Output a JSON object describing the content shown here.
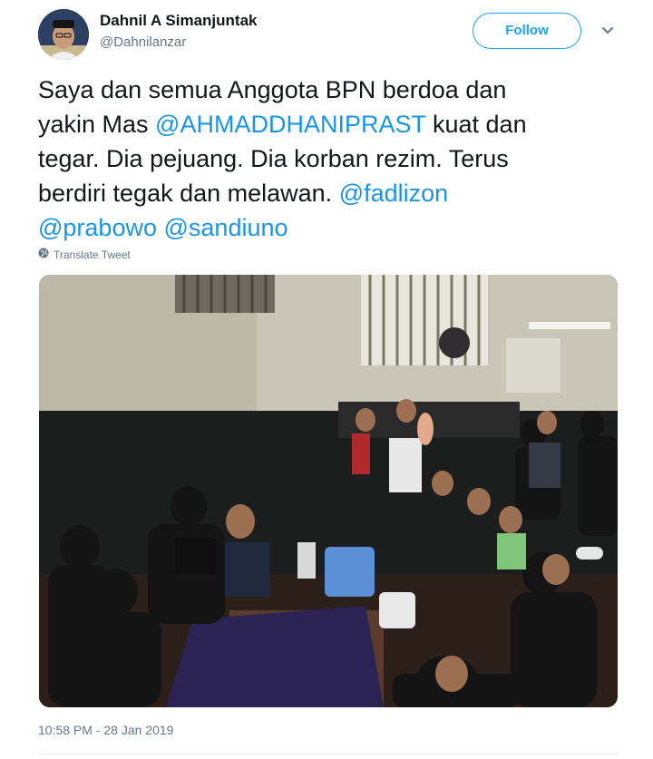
{
  "author": {
    "name": "Dahnil A Simanjuntak",
    "handle": "@Dahnilanzar"
  },
  "follow_label": "Follow",
  "tweet": {
    "lines": [
      [
        {
          "text": "Saya dan semua Anggota BPN berdoa dan"
        }
      ],
      [
        {
          "text": "yakin  Mas "
        },
        {
          "text": "@AHMADDHANIPRAST"
        },
        {
          "text": " kuat dan"
        }
      ],
      [
        {
          "text": "tegar. Dia pejuang. Dia korban rezim. Terus"
        }
      ],
      [
        {
          "text": "berdiri tegak dan melawan. "
        },
        {
          "text": "@fadlizon"
        }
      ],
      [
        {
          "text": "@prabowo"
        },
        {
          "text": " "
        },
        {
          "text": "@sandiuno"
        }
      ]
    ]
  },
  "translate_label": "Translate Tweet",
  "timestamp": "10:58 PM - 28 Jan 2019",
  "colors": {
    "link": "#1b95e0",
    "follow": "#1da1f2",
    "secondary_text": "#657786"
  },
  "icons": {
    "translate": "globe-icon",
    "menu": "chevron-down-icon"
  }
}
